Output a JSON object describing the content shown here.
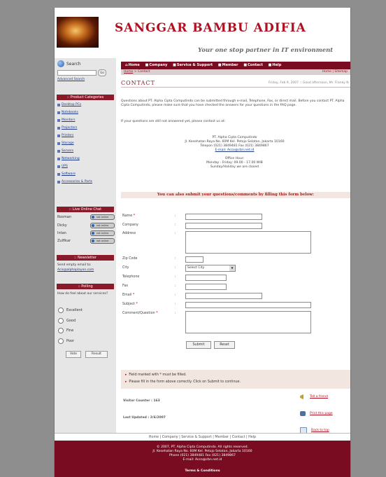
{
  "header": {
    "brand": "SANGGAR BAMBU ADIFIA",
    "tagline": "Your one stop partner in IT environment"
  },
  "sidebar": {
    "search_title": "Search",
    "search_go": "Go",
    "advanced_search": "Advanced Search",
    "categories_title": ":: Product Categories",
    "categories": [
      "Desktop PCs",
      "Notebooks",
      "Monitors",
      "Projectors",
      "Printers",
      "Storage",
      "Servers",
      "Networking",
      "UPS",
      "Software",
      "Accessories & Parts"
    ],
    "chat_title": ":: Live Online Chat",
    "chat": [
      {
        "name": "Rosman",
        "status": "not online"
      },
      {
        "name": "Dicky",
        "status": "not online"
      },
      {
        "name": "Intan",
        "status": "not online"
      },
      {
        "name": "Zulfikar",
        "status": "not online"
      }
    ],
    "newsletter_title": ":: Newsletter",
    "newsletter_text": "Send empty email to:",
    "newsletter_email": "Acis@alphaplayen.com",
    "polling_title": ":: Polling",
    "polling_question": "How do feel about our services?",
    "polling_options": [
      "Excellent",
      "Good",
      "Fine",
      "Poor"
    ],
    "vote_label": "Vote",
    "result_label": "Result"
  },
  "nav": {
    "items": [
      "Home",
      "Company",
      "Service & Support",
      "Member",
      "Contact",
      "Help"
    ]
  },
  "breadcrumb": {
    "home": "Home",
    "current": "Contact",
    "right": "Home | Sitemap"
  },
  "page": {
    "title": "CONTACT",
    "date_greeting": "Friday, Feb 9, 2007 :: Good afternoon, Mr. Franky N."
  },
  "content": {
    "intro": "Questions about PT. Alpha Cipta Computindo can be submitted through e-mail, Telephone, Fax, or direct mail. Before you contact PT. Alpha Cipta Computindo, please make sure that you have checked the answers for your questions in the FAQ page.",
    "intro2": "If your questions are still not answered yet, please contact us at:",
    "address_lines": [
      "PT. Alpha Cipta Computindo",
      "Jl. Kesehatan Raya No. 60M Kel. Petojo Selatan, Jakarta 10160",
      "Telepon (021) 3849481 Fax (021) 3849867",
      "E-mail: Acco@cbn.net.id"
    ],
    "office_hours_title": "Office Hour:",
    "office_hours": "Monday - Friday: 09.00 - 17.00 WIB",
    "office_closed": "Sunday/Holiday we are closed",
    "form_prompt": "You can also submit your questions/comments by filling this form below:"
  },
  "form": {
    "labels": {
      "name": "Name",
      "company": "Company",
      "address": "Address",
      "zip": "Zip Code",
      "city": "City",
      "telephone": "Telephone",
      "fax": "Fax",
      "email": "Email",
      "subject": "Subject",
      "comment": "Comment/Question"
    },
    "required_mark": "*",
    "city_selected": "Select City",
    "submit_label": "Submit",
    "reset_label": "Reset"
  },
  "notes": [
    "Field marked with * must be filled.",
    "Please fill in the form above correctly. Click on Submit to continue."
  ],
  "stats": {
    "visitor": "Visitor Counter : 163",
    "updated": "Last Updated : 2/6/2007"
  },
  "tools": {
    "tell": "Tell a friend",
    "print": "Print this page",
    "top": "Back to top"
  },
  "footer": {
    "links": "Home | Company | Service & Support | Member | Contact | Help",
    "copyright": "© 2007, PT. Alpha Cipta Computindo. All rights reserved.",
    "address": "Jl. Kesehatan Raya No. 60M Kel. Petojo Selatan, Jakarta 10160",
    "phone": "Phone (021) 3849481 Fax (021) 3849867",
    "email": "E-mail: Acco@cbn.net.id",
    "terms": "Terms & Conditions"
  },
  "colors": {
    "brand_red": "#b01020",
    "maroon": "#7a0c22",
    "sidebar_bg": "#e6e6e6"
  }
}
